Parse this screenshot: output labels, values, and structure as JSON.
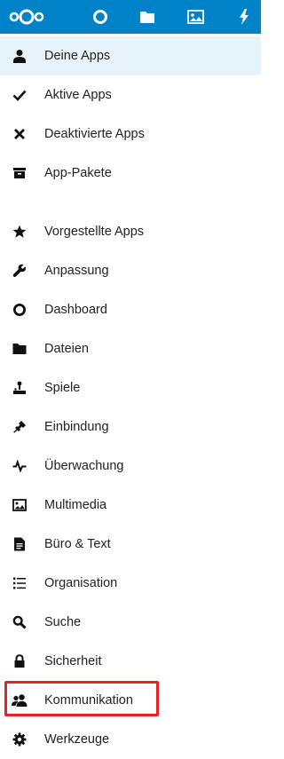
{
  "header": {
    "logo": "nextcloud-logo",
    "apps": [
      {
        "name": "dashboard",
        "icon": "circle-icon"
      },
      {
        "name": "files",
        "icon": "folder-icon"
      },
      {
        "name": "photos",
        "icon": "image-icon"
      },
      {
        "name": "activity",
        "icon": "lightning-icon"
      }
    ],
    "colors": {
      "background": "#0082c9",
      "icon": "#ffffff"
    }
  },
  "nav": {
    "active_background": "#e6f3fa",
    "items": [
      {
        "label": "Deine Apps",
        "icon": "user-icon",
        "active": true
      },
      {
        "label": "Aktive Apps",
        "icon": "check-icon"
      },
      {
        "label": "Deaktivierte Apps",
        "icon": "close-icon"
      },
      {
        "label": "App-Pakete",
        "icon": "archive-icon"
      },
      {
        "label": "Vorgestellte Apps",
        "icon": "star-icon"
      },
      {
        "label": "Anpassung",
        "icon": "wrench-icon"
      },
      {
        "label": "Dashboard",
        "icon": "circle-icon"
      },
      {
        "label": "Dateien",
        "icon": "folder-icon"
      },
      {
        "label": "Spiele",
        "icon": "joystick-icon"
      },
      {
        "label": "Einbindung",
        "icon": "plug-icon"
      },
      {
        "label": "Überwachung",
        "icon": "pulse-icon"
      },
      {
        "label": "Multimedia",
        "icon": "image-icon"
      },
      {
        "label": "Büro & Text",
        "icon": "document-icon"
      },
      {
        "label": "Organisation",
        "icon": "list-icon"
      },
      {
        "label": "Suche",
        "icon": "search-icon"
      },
      {
        "label": "Sicherheit",
        "icon": "lock-icon"
      },
      {
        "label": "Kommunikation",
        "icon": "users-icon",
        "highlighted": true
      },
      {
        "label": "Werkzeuge",
        "icon": "gear-icon"
      }
    ]
  },
  "highlight_color": "#e3222b"
}
